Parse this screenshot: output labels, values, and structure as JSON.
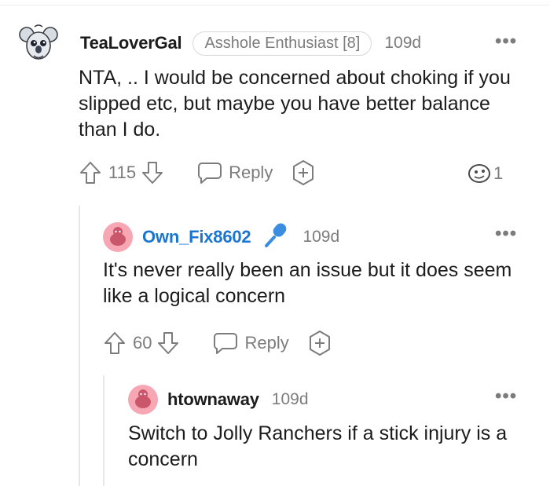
{
  "colors": {
    "meta_grey": "#7c7c7c",
    "accent_blue": "#1a75d1",
    "mic_blue": "#3a8de0",
    "avatar_pink": "#f7a7b3",
    "thread_line": "#e5e7ea"
  },
  "comments": [
    {
      "username": "TeaLoverGal",
      "flair": "Asshole Enthusiast [8]",
      "age": "109d",
      "more": "•••",
      "text": "NTA, .. I would be concerned about choking if you slipped etc, but maybe you have better balance than I do.",
      "score": "115",
      "reply_label": "Reply",
      "reaction_count": "1"
    },
    {
      "username": "Own_Fix8602",
      "badge_icon": "microphone-icon",
      "age": "109d",
      "more": "•••",
      "text": "It's never really been an issue but it does seem like a logical concern",
      "score": "60",
      "reply_label": "Reply"
    },
    {
      "username": "htownaway",
      "age": "109d",
      "more": "•••",
      "text": "Switch to Jolly Ranchers if a stick injury is a concern"
    }
  ]
}
